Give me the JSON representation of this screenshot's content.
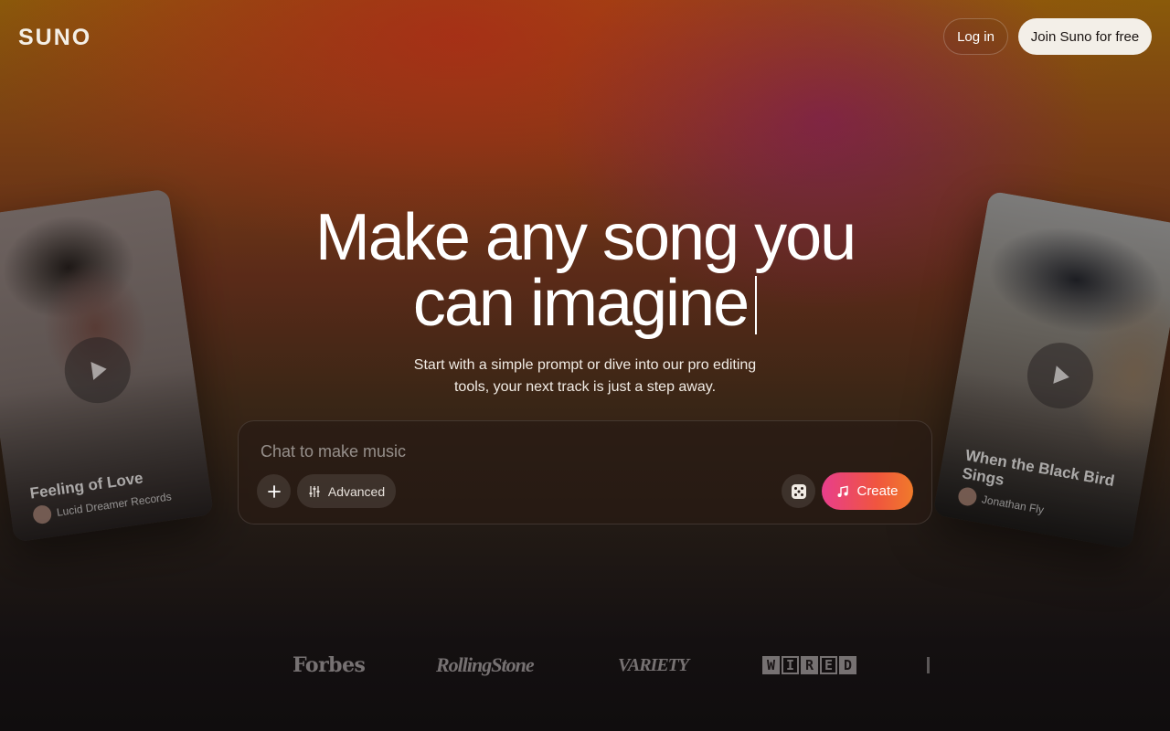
{
  "header": {
    "logo": "SUNO",
    "login_label": "Log in",
    "join_label": "Join Suno for free"
  },
  "hero": {
    "title_line1": "Make any song you",
    "title_line2": "can imagine",
    "subtitle_line1": "Start with a simple prompt or dive into our pro editing",
    "subtitle_line2": "tools, your next track is just a step away."
  },
  "chat": {
    "placeholder": "Chat to make music",
    "advanced_label": "Advanced",
    "create_label": "Create",
    "icons": {
      "plus": "plus-icon",
      "advanced": "sliders-icon",
      "dice": "dice-icon",
      "create": "music-note-icon"
    }
  },
  "cards": [
    {
      "title": "Feeling of Love",
      "artist": "Lucid Dreamer Records"
    },
    {
      "title": "When the Black Bird Sings",
      "artist": "Jonathan Fly"
    }
  ],
  "press": [
    "Forbes",
    "RollingStone",
    "VARIETY",
    "WIRED"
  ],
  "colors": {
    "create_gradient_start": "#e83e8c",
    "create_gradient_end": "#f07a2a",
    "join_button_bg": "#f3efe8"
  }
}
